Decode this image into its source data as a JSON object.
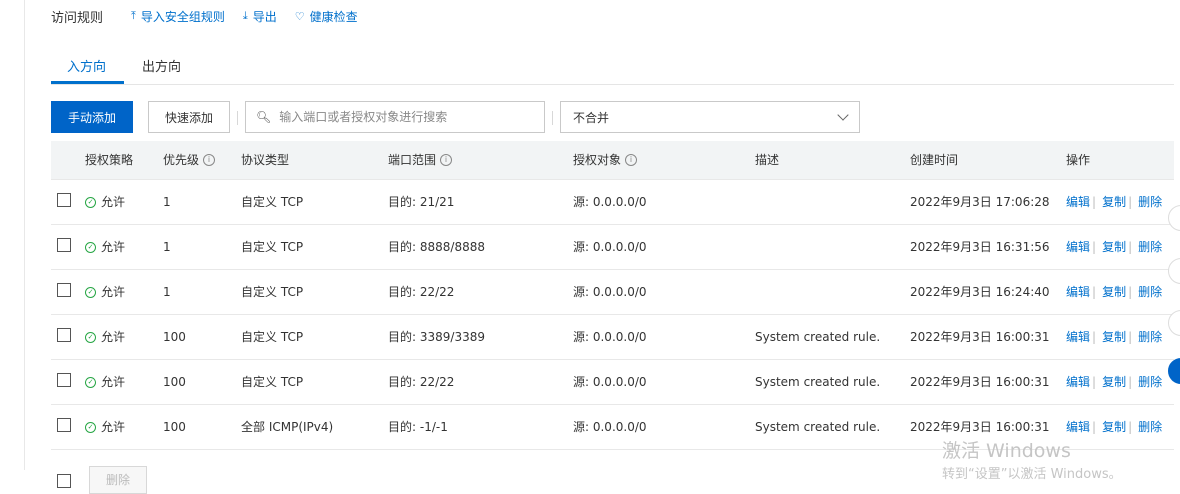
{
  "header": {
    "title": "访问规则",
    "links": [
      {
        "icon": "upload-icon",
        "glyph": "⤒",
        "label": "导入安全组规则"
      },
      {
        "icon": "download-icon",
        "glyph": "⤓",
        "label": "导出"
      },
      {
        "icon": "shield-check-icon",
        "glyph": "♡",
        "label": "健康检查"
      }
    ]
  },
  "tabs": [
    {
      "label": "入方向",
      "active": true
    },
    {
      "label": "出方向",
      "active": false
    }
  ],
  "toolbar": {
    "manual_add": "手动添加",
    "quick_add": "快速添加",
    "search_placeholder": "输入端口或者授权对象进行搜索",
    "merge_select": "不合并"
  },
  "table": {
    "columns": [
      "授权策略",
      "优先级",
      "协议类型",
      "端口范围",
      "授权对象",
      "描述",
      "创建时间",
      "操作"
    ],
    "rows": [
      {
        "policy": "允许",
        "priority": "1",
        "protocol": "自定义 TCP",
        "port": "目的: 21/21",
        "source": "源: 0.0.0.0/0",
        "desc": "",
        "created": "2022年9月3日 17:06:28"
      },
      {
        "policy": "允许",
        "priority": "1",
        "protocol": "自定义 TCP",
        "port": "目的: 8888/8888",
        "source": "源: 0.0.0.0/0",
        "desc": "",
        "created": "2022年9月3日 16:31:56"
      },
      {
        "policy": "允许",
        "priority": "1",
        "protocol": "自定义 TCP",
        "port": "目的: 22/22",
        "source": "源: 0.0.0.0/0",
        "desc": "",
        "created": "2022年9月3日 16:24:40"
      },
      {
        "policy": "允许",
        "priority": "100",
        "protocol": "自定义 TCP",
        "port": "目的: 3389/3389",
        "source": "源: 0.0.0.0/0",
        "desc": "System created rule.",
        "created": "2022年9月3日 16:00:31"
      },
      {
        "policy": "允许",
        "priority": "100",
        "protocol": "自定义 TCP",
        "port": "目的: 22/22",
        "source": "源: 0.0.0.0/0",
        "desc": "System created rule.",
        "created": "2022年9月3日 16:00:31"
      },
      {
        "policy": "允许",
        "priority": "100",
        "protocol": "全部 ICMP(IPv4)",
        "port": "目的: -1/-1",
        "source": "源: 0.0.0.0/0",
        "desc": "System created rule.",
        "created": "2022年9月3日 16:00:31"
      }
    ],
    "actions": [
      "编辑",
      "复制",
      "删除"
    ],
    "action_separator": "|"
  },
  "footer": {
    "delete_button": "删除"
  },
  "watermark": {
    "line1": "激活 Windows",
    "line2": "转到“设置”以激活 Windows。"
  },
  "colors": {
    "primary": "#0064c8",
    "link": "#0070cc",
    "success": "#27a645"
  }
}
